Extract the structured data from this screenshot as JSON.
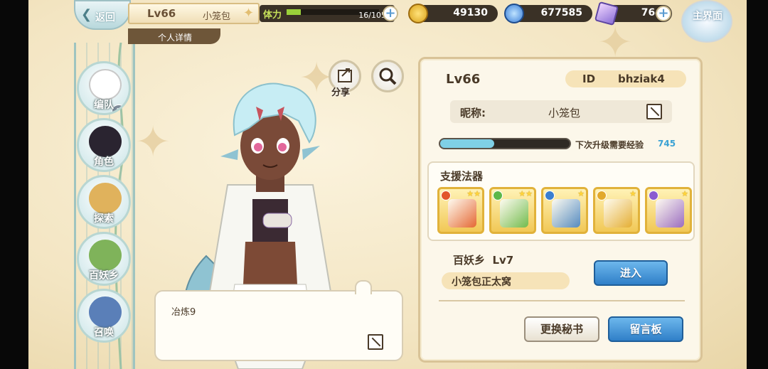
{
  "topbar": {
    "back_label": "返回",
    "home_label": "主界面",
    "level": "Lv66",
    "player_name": "小笼包",
    "detail_tab": "个人详情",
    "stamina_label": "体力",
    "stamina_text": "16/105",
    "stamina_fraction": 0.15,
    "gold": "49130",
    "spirit": "677585",
    "crystal": "764"
  },
  "share_label": "分享",
  "sidebar": {
    "items": [
      {
        "label": "编队",
        "badge": "2"
      },
      {
        "label": "角色"
      },
      {
        "label": "探索"
      },
      {
        "label": "百妖乡"
      },
      {
        "label": "召唤"
      }
    ]
  },
  "bubble": {
    "text": "冶炼9"
  },
  "profile": {
    "level": "Lv66",
    "id_key": "ID",
    "id_value": "bhziak4",
    "nickname_key": "昵称:",
    "nickname_value": "小笼包",
    "exp_label": "下次升级需要经验",
    "exp_value": "745",
    "exp_fraction": 0.42,
    "artifacts_title": "支援法器",
    "artifacts": [
      {
        "icon": "umbrella-artifact-icon",
        "element_color": "#e2562c",
        "stars": "★★"
      },
      {
        "icon": "crossbow-artifact-icon",
        "element_color": "#5cb84a",
        "stars": "★★"
      },
      {
        "icon": "ship-artifact-icon",
        "element_color": "#3a7fd0",
        "stars": "★"
      },
      {
        "icon": "ring-artifact-icon",
        "element_color": "#e2a92c",
        "stars": "★"
      },
      {
        "icon": "blade-artifact-icon",
        "element_color": "#8b5cd0",
        "stars": "★"
      }
    ],
    "village_label": "百妖乡",
    "village_level": "Lv7",
    "village_name": "小笼包正太窝",
    "enter_button": "进入",
    "change_book_button": "更换秘书",
    "message_board_button": "留言板"
  }
}
